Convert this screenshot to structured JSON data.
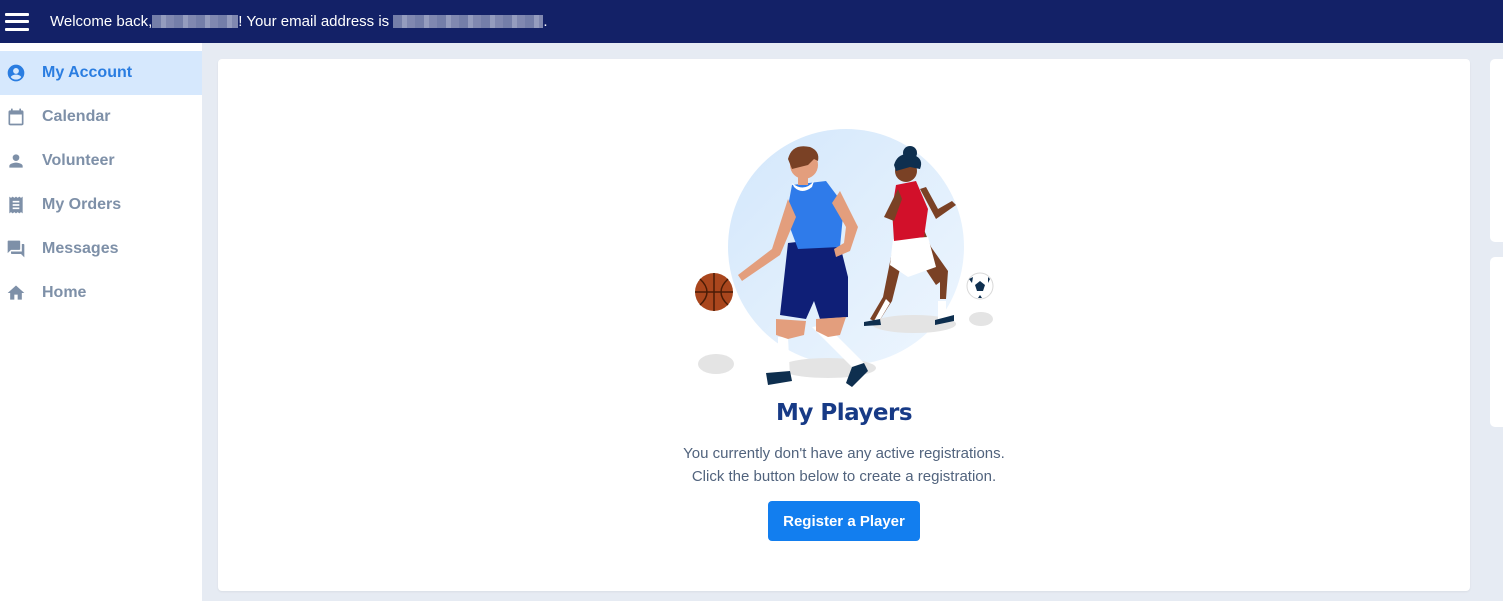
{
  "header": {
    "welcome_prefix": "Welcome back, ",
    "welcome_middle": "! Your email address is ",
    "welcome_suffix": "."
  },
  "sidebar": {
    "items": [
      {
        "label": "My Account",
        "icon": "account-circle-icon",
        "active": true
      },
      {
        "label": "Calendar",
        "icon": "calendar-icon"
      },
      {
        "label": "Volunteer",
        "icon": "person-icon"
      },
      {
        "label": "My Orders",
        "icon": "receipt-icon"
      },
      {
        "label": "Messages",
        "icon": "messages-icon"
      },
      {
        "label": "Home",
        "icon": "home-icon"
      }
    ]
  },
  "main": {
    "title": "My Players",
    "description_line1": "You currently don't have any active registrations.",
    "description_line2": "Click the button below to create a registration.",
    "register_button": "Register a Player"
  },
  "colors": {
    "topbar": "#132167",
    "accent": "#127eef",
    "title": "#173a86",
    "active_bg": "#d6e8fd"
  }
}
